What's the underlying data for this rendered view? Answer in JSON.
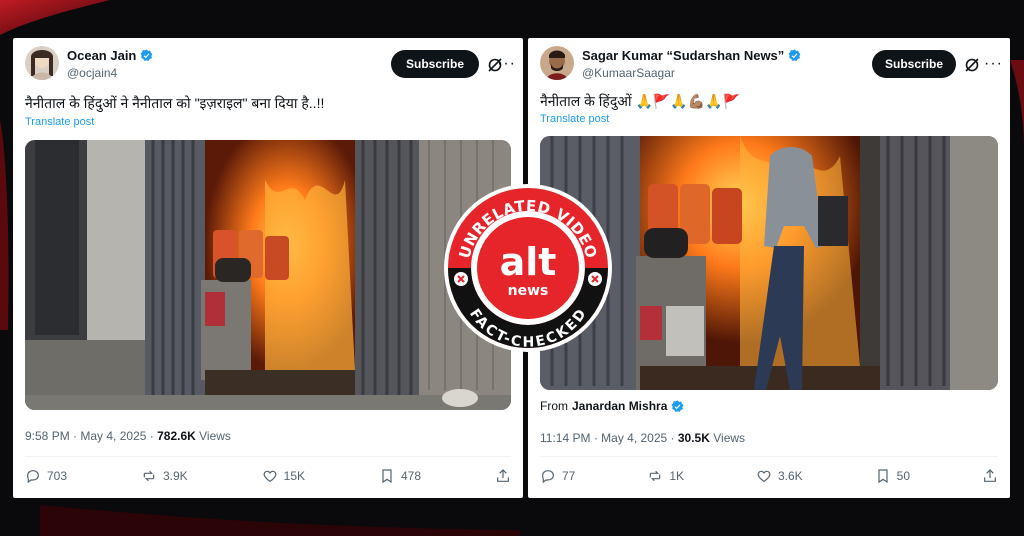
{
  "left_post": {
    "author_name": "Ocean Jain",
    "handle": "@ocjain4",
    "subscribe_label": "Subscribe",
    "text": "नैनीताल के हिंदुओं ने नैनीताल को \"इज़राइल\" बना दिया है..!!",
    "translate_label": "Translate post",
    "time": "9:58 PM",
    "date": "May 4, 2025",
    "views_count": "782.6K",
    "views_label": "Views",
    "replies": "703",
    "reposts": "3.9K",
    "likes": "15K",
    "bookmarks": "478"
  },
  "right_post": {
    "author_name": "Sagar Kumar “Sudarshan News”",
    "handle": "@KumaarSaagar",
    "subscribe_label": "Subscribe",
    "text": "नैनीताल के हिंदुओं 🙏🚩🙏💪🏽🙏🚩",
    "translate_label": "Translate post",
    "from_label": "From",
    "from_name": "Janardan Mishra",
    "time": "11:14 PM",
    "date": "May 4, 2025",
    "views_count": "30.5K",
    "views_label": "Views",
    "replies": "77",
    "reposts": "1K",
    "likes": "3.6K",
    "bookmarks": "50"
  },
  "badge": {
    "top_text": "UNRELATED VIDEO",
    "logo_text": "alt",
    "logo_sub": "news",
    "bottom_text": "FACT-CHECKED"
  },
  "colors": {
    "badge_red": "#e6252b",
    "link_blue": "#1d9bf0",
    "verified_blue": "#1d9bf0",
    "fire": "#ff7a1a"
  },
  "icons": {
    "verified": "verified-badge-icon",
    "grok": "grok-icon",
    "more": "more-icon",
    "reply": "reply-icon",
    "repost": "repost-icon",
    "like": "heart-icon",
    "bookmark": "bookmark-icon",
    "share": "share-icon"
  }
}
